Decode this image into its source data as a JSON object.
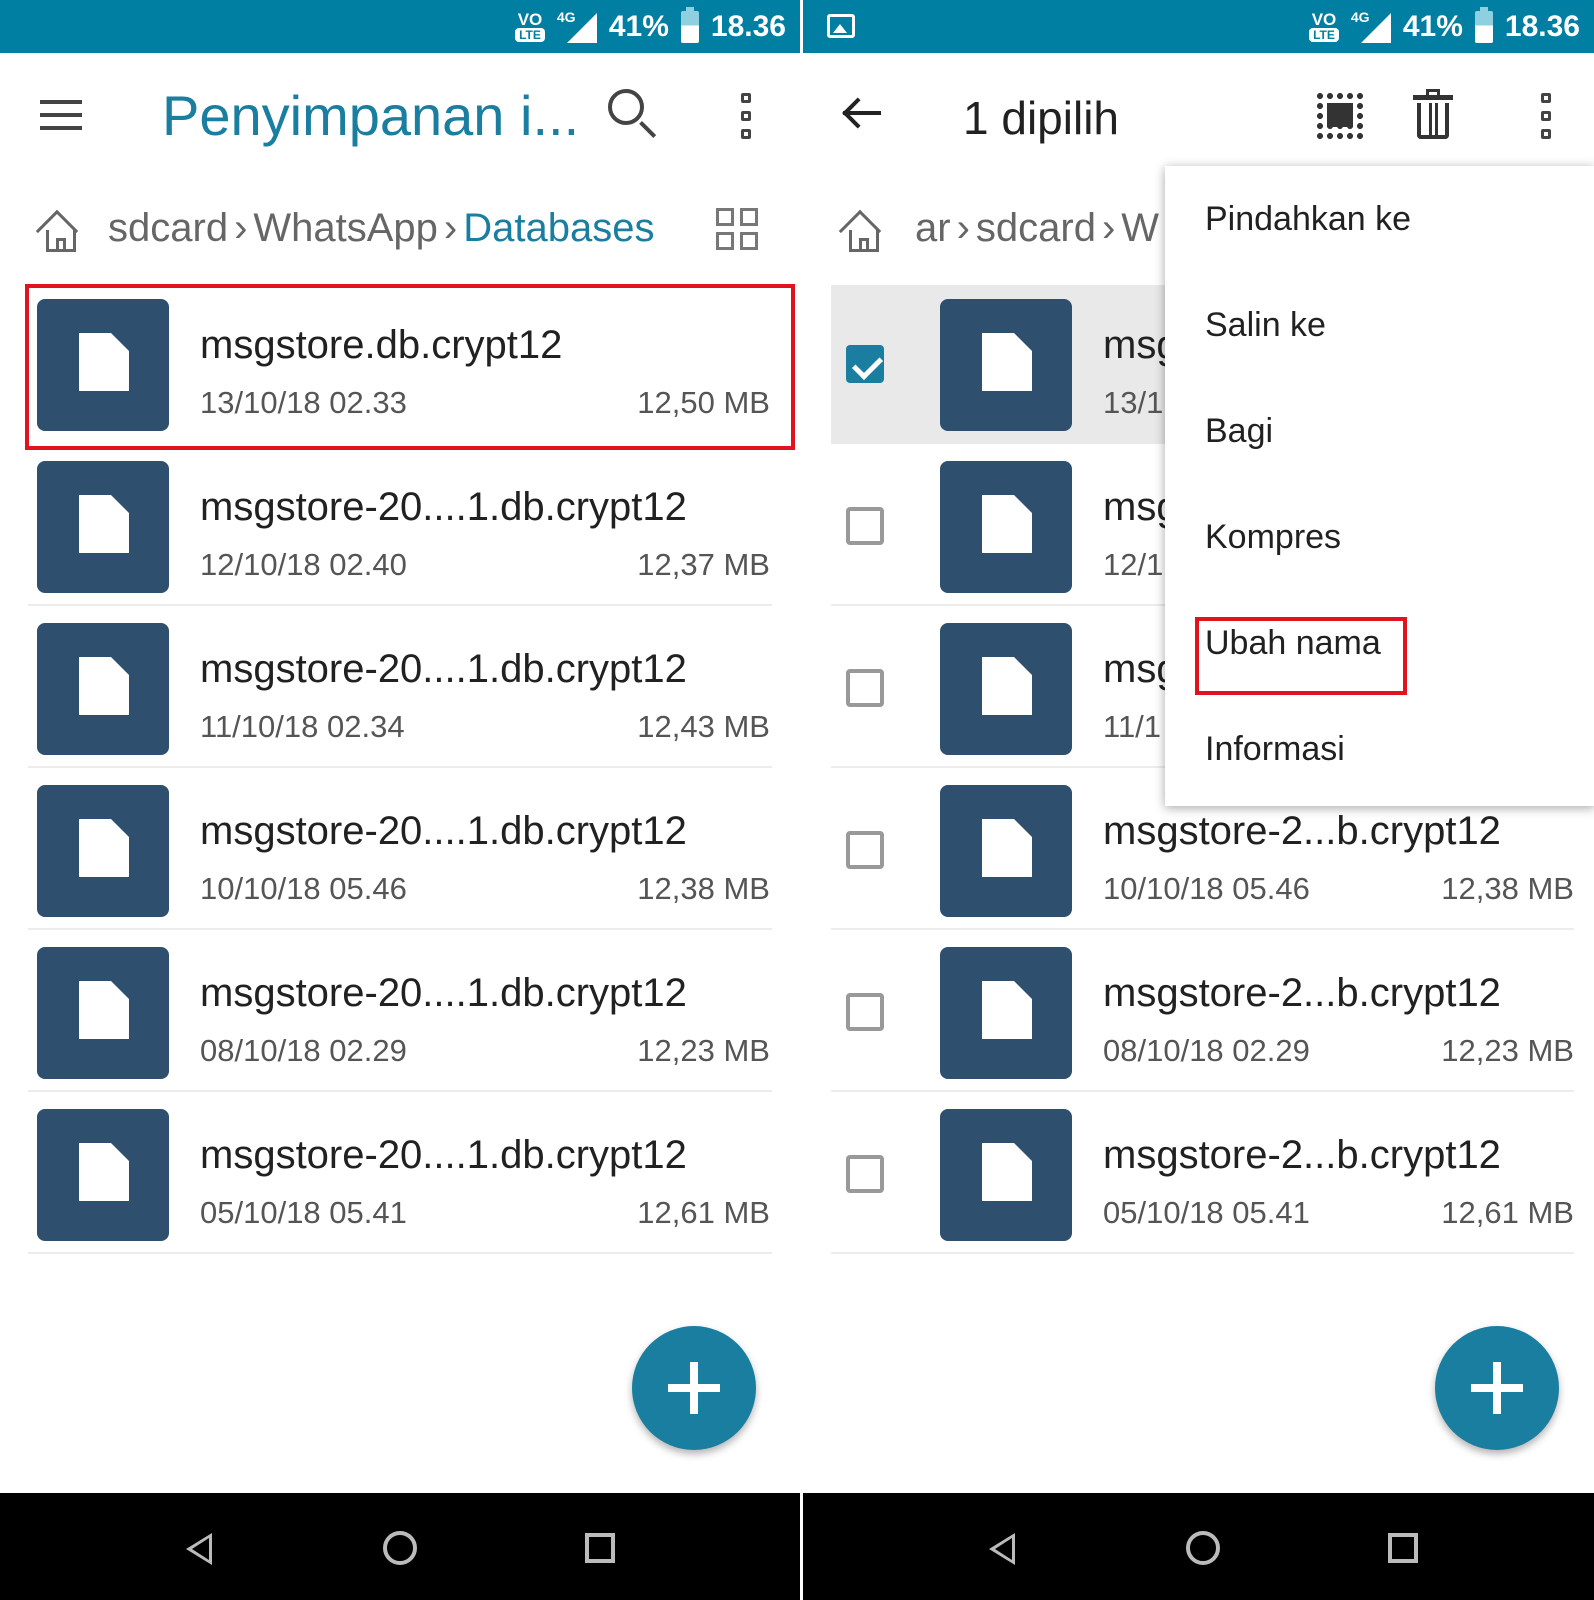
{
  "status_bar": {
    "volte": "VO",
    "lte": "LTE",
    "network": "4G",
    "battery": "41%",
    "time": "18.36"
  },
  "left_screen": {
    "toolbar": {
      "title": "Penyimpanan i..."
    },
    "breadcrumb": [
      {
        "label": "sdcard"
      },
      {
        "label": "WhatsApp"
      },
      {
        "label": "Databases"
      }
    ],
    "files": [
      {
        "name": "msgstore.db.crypt12",
        "date": "13/10/18 02.33",
        "size": "12,50 MB"
      },
      {
        "name": "msgstore-20....1.db.crypt12",
        "date": "12/10/18 02.40",
        "size": "12,37 MB"
      },
      {
        "name": "msgstore-20....1.db.crypt12",
        "date": "11/10/18 02.34",
        "size": "12,43 MB"
      },
      {
        "name": "msgstore-20....1.db.crypt12",
        "date": "10/10/18 05.46",
        "size": "12,38 MB"
      },
      {
        "name": "msgstore-20....1.db.crypt12",
        "date": "08/10/18 02.29",
        "size": "12,23 MB"
      },
      {
        "name": "msgstore-20....1.db.crypt12",
        "date": "05/10/18 05.41",
        "size": "12,61 MB"
      }
    ]
  },
  "right_screen": {
    "toolbar": {
      "selected_count": "1 dipilih"
    },
    "breadcrumb": [
      {
        "label": "ar"
      },
      {
        "label": "sdcard"
      },
      {
        "label": "W"
      }
    ],
    "files": [
      {
        "name": "msg",
        "date": "13/1",
        "size": "",
        "checked": true
      },
      {
        "name": "msg",
        "date": "12/1",
        "size": "",
        "checked": false
      },
      {
        "name": "msg",
        "date": "11/1",
        "size": "",
        "checked": false
      },
      {
        "name": "msgstore-2...b.crypt12",
        "date": "10/10/18 05.46",
        "size": "12,38 MB",
        "checked": false
      },
      {
        "name": "msgstore-2...b.crypt12",
        "date": "08/10/18 02.29",
        "size": "12,23 MB",
        "checked": false
      },
      {
        "name": "msgstore-2...b.crypt12",
        "date": "05/10/18 05.41",
        "size": "12,61 MB",
        "checked": false
      }
    ],
    "context_menu": [
      {
        "label": "Pindahkan ke"
      },
      {
        "label": "Salin ke"
      },
      {
        "label": "Bagi"
      },
      {
        "label": "Kompres"
      },
      {
        "label": "Ubah nama"
      },
      {
        "label": "Informasi"
      }
    ]
  },
  "colors": {
    "status_bar": "#017fa3",
    "accent": "#1a7ea1",
    "file_tile": "#2f4f6e",
    "highlight_box": "#e0131f"
  },
  "icons": [
    "menu-icon",
    "search-icon",
    "more-vert-icon",
    "home-icon",
    "grid-view-icon",
    "file-icon",
    "back-arrow-icon",
    "select-all-icon",
    "trash-icon",
    "add-icon",
    "nav-back-icon",
    "nav-home-icon",
    "nav-recent-icon"
  ]
}
